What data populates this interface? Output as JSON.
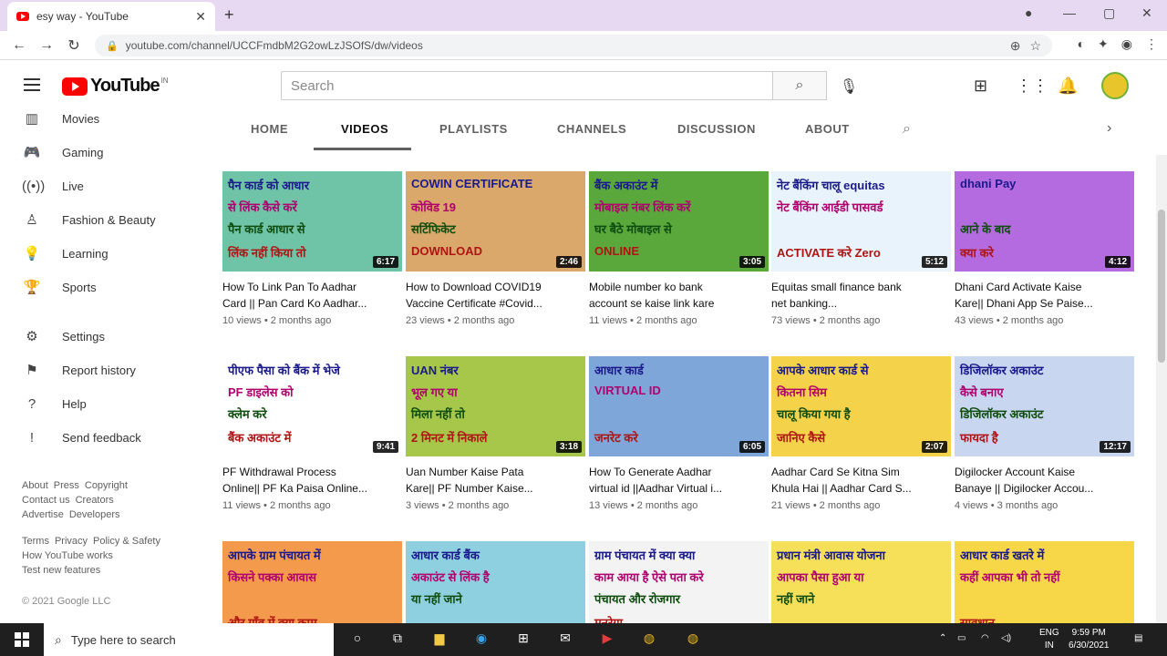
{
  "browser": {
    "tab_title": "esy way - YouTube",
    "url": "youtube.com/channel/UCCFmdbM2G2owLzJSOfS/dw/videos"
  },
  "header": {
    "logo_text": "YouTube",
    "logo_superscript": "IN",
    "search_placeholder": "Search"
  },
  "sidebar": {
    "items": [
      {
        "label": "Movies",
        "icon": "movies-icon"
      },
      {
        "label": "Gaming",
        "icon": "gaming-icon"
      },
      {
        "label": "Live",
        "icon": "live-icon"
      },
      {
        "label": "Fashion & Beauty",
        "icon": "fashion-icon"
      },
      {
        "label": "Learning",
        "icon": "learning-icon"
      },
      {
        "label": "Sports",
        "icon": "sports-icon"
      },
      {
        "label": "Settings",
        "icon": "settings-icon"
      },
      {
        "label": "Report history",
        "icon": "flag-icon"
      },
      {
        "label": "Help",
        "icon": "help-icon"
      },
      {
        "label": "Send feedback",
        "icon": "feedback-icon"
      }
    ],
    "links1": [
      "About",
      "Press",
      "Copyright",
      "Contact us",
      "Creators",
      "Advertise",
      "Developers"
    ],
    "links2": [
      "Terms",
      "Privacy",
      "Policy & Safety",
      "How YouTube works",
      "Test new features"
    ],
    "copyright": "© 2021 Google LLC"
  },
  "channel_tabs": [
    "HOME",
    "VIDEOS",
    "PLAYLISTS",
    "CHANNELS",
    "DISCUSSION",
    "ABOUT"
  ],
  "videos": [
    {
      "title1": "How To Link Pan To Aadhar",
      "title2": "Card || Pan Card Ko Aadhar...",
      "meta": "10 views • 2 months ago",
      "duration": "6:17",
      "thumb_text": [
        "पैन कार्ड को आधार",
        "से लिंक कैसे करें",
        "पैन कार्ड आधार से",
        "लिंक नहीं किया तो"
      ],
      "bg": "#6fc3a6"
    },
    {
      "title1": "How to Download COVID19",
      "title2": "Vaccine Certificate #Covid...",
      "meta": "23 views • 2 months ago",
      "duration": "2:46",
      "thumb_text": [
        "COWIN  CERTIFICATE",
        "कोविड 19",
        "सर्टिफिकेट",
        "DOWNLOAD"
      ],
      "bg": "#d9a86a"
    },
    {
      "title1": "Mobile number ko bank",
      "title2": "account se kaise link kare",
      "meta": "11 views • 2 months ago",
      "duration": "3:05",
      "thumb_text": [
        "बैंक अकाउंट में",
        "मोबाइल नंबर लिंक करें",
        "घर बैठे मोबाइल से",
        "ONLINE"
      ],
      "bg": "#5aa83c"
    },
    {
      "title1": "Equitas small finance bank",
      "title2": "net banking...",
      "meta": "73 views • 2 months ago",
      "duration": "5:12",
      "thumb_text": [
        "नेट बैंकिंग चालू  equitas",
        "नेट बैंकिंग आईडी पासवर्ड",
        "",
        "ACTIVATE करे   Zero"
      ],
      "bg": "#e9f3fb"
    },
    {
      "title1": "Dhani Card Activate Kaise",
      "title2": "Kare|| Dhani App Se Paise...",
      "meta": "43 views • 2 months ago",
      "duration": "4:12",
      "thumb_text": [
        "dhani  Pay",
        "",
        "आने के बाद",
        "क्या करे"
      ],
      "bg": "#b56be0"
    },
    {
      "title1": "PF Withdrawal Process",
      "title2": "Online|| PF Ka Paisa Online...",
      "meta": "11 views • 2 months ago",
      "duration": "9:41",
      "thumb_text": [
        "पीएफ पैसा को बैंक में भेजे",
        "PF डाइलेस को",
        "क्लेम करे",
        "बैंक अकाउंट में"
      ],
      "bg": "#ffffff"
    },
    {
      "title1": "Uan Number Kaise Pata",
      "title2": "Kare|| PF Number Kaise...",
      "meta": "3 views • 2 months ago",
      "duration": "3:18",
      "thumb_text": [
        "UAN नंबर",
        "भूल गए या",
        "मिला नहीं तो",
        "2 मिनट में निकाले"
      ],
      "bg": "#a7c74a"
    },
    {
      "title1": "How To Generate Aadhar",
      "title2": "virtual id ||Aadhar Virtual i...",
      "meta": "13 views • 2 months ago",
      "duration": "6:05",
      "thumb_text": [
        "आधार कार्ड",
        "VIRTUAL ID",
        "",
        "जनरेट करे"
      ],
      "bg": "#7fa6d8"
    },
    {
      "title1": "Aadhar Card Se Kitna Sim",
      "title2": "Khula Hai || Aadhar Card S...",
      "meta": "21 views • 2 months ago",
      "duration": "2:07",
      "thumb_text": [
        "आपके आधार कार्ड से",
        "कितना सिम",
        "चालू किया गया है",
        "जानिए कैसे"
      ],
      "bg": "#f4d34b"
    },
    {
      "title1": "Digilocker Account Kaise",
      "title2": "Banaye || Digilocker Accou...",
      "meta": "4 views • 3 months ago",
      "duration": "12:17",
      "thumb_text": [
        "डिजिलॉकर अकाउंट",
        "कैसे बनाए",
        "डिजिलॉकर अकाउंट",
        "फायदा है"
      ],
      "bg": "#c8d6f0"
    },
    {
      "title1": "",
      "title2": "",
      "meta": "",
      "duration": "",
      "thumb_text": [
        "आपके ग्राम पंचायत में",
        "किसने पक्का आवास",
        "",
        "और गाँव में क्या काम"
      ],
      "bg": "#f39a4c"
    },
    {
      "title1": "",
      "title2": "",
      "meta": "",
      "duration": "",
      "thumb_text": [
        "आधार कार्ड बैंक",
        "अकाउंट से लिंक है",
        "या नहीं जाने",
        ""
      ],
      "bg": "#8fd0e0"
    },
    {
      "title1": "",
      "title2": "",
      "meta": "",
      "duration": "",
      "thumb_text": [
        "ग्राम पंचायत में क्या क्या",
        "काम आया है ऐसे पता करे",
        "पंचायत और रोजगार",
        "मनरेगा"
      ],
      "bg": "#f3f3f3"
    },
    {
      "title1": "",
      "title2": "",
      "meta": "",
      "duration": "",
      "thumb_text": [
        "प्रधान मंत्री आवास योजना",
        "आपका पैसा हुआ या",
        "नहीं जाने",
        ""
      ],
      "bg": "#f6e05a"
    },
    {
      "title1": "",
      "title2": "",
      "meta": "",
      "duration": "",
      "thumb_text": [
        "आधार कार्ड खतरे में",
        "कहीं आपका भी तो नहीं",
        "",
        "सावधान"
      ],
      "bg": "#f7d648"
    }
  ],
  "taskbar": {
    "search_placeholder": "Type here to search",
    "lang": "ENG",
    "region": "IN",
    "time": "9:59 PM",
    "date": "6/30/2021"
  },
  "colors": {
    "accent": "#ff0000",
    "tabbar": "#e8d9f3"
  }
}
